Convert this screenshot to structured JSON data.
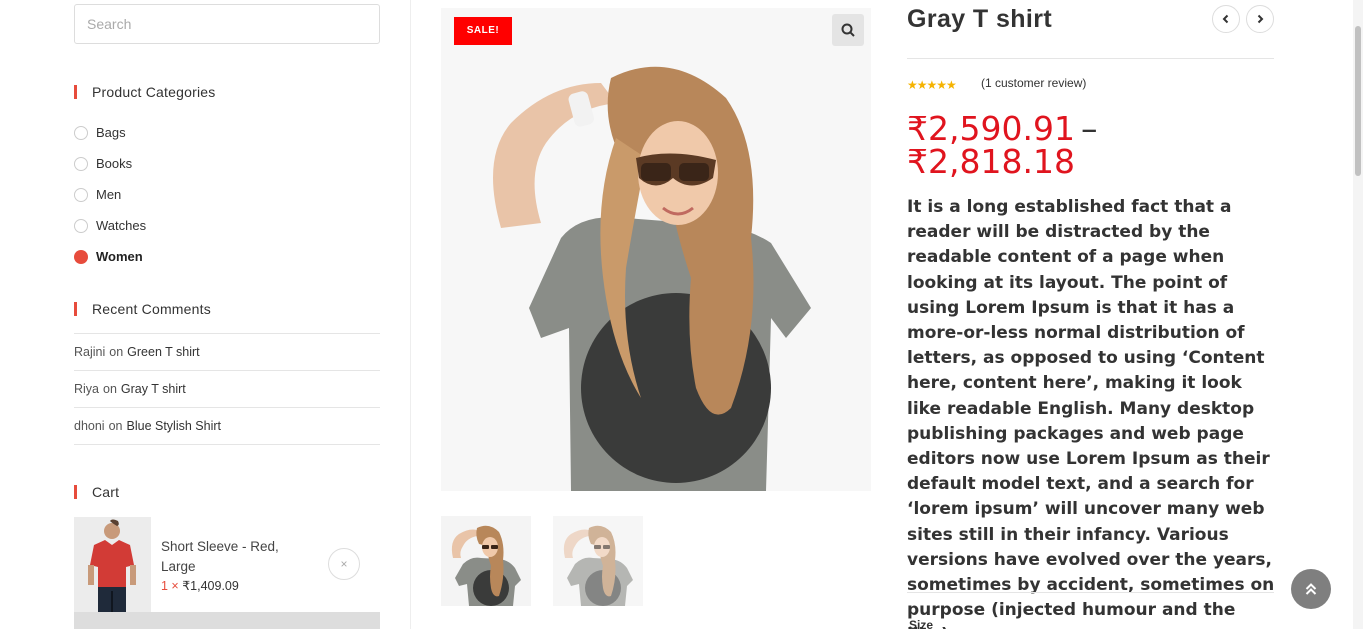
{
  "search": {
    "placeholder": "Search"
  },
  "categories": {
    "title": "Product Categories",
    "items": [
      {
        "label": "Bags"
      },
      {
        "label": "Books"
      },
      {
        "label": "Men"
      },
      {
        "label": "Watches"
      },
      {
        "label": "Women",
        "selected": true
      }
    ]
  },
  "recent_comments": {
    "title": "Recent Comments",
    "items": [
      {
        "author": "Rajini",
        "on": "on",
        "post": "Green T shirt"
      },
      {
        "author": "Riya",
        "on": "on",
        "post": "Gray T shirt"
      },
      {
        "author": "dhoni",
        "on": "on",
        "post": "Blue Stylish Shirt"
      }
    ]
  },
  "cart": {
    "title": "Cart",
    "item": {
      "name": "Short Sleeve - Red, Large",
      "qty": "1 ×",
      "price": "₹1,409.09",
      "remove": "×"
    }
  },
  "product": {
    "sale_badge": "SALE!",
    "title": "Gray T shirt",
    "rating_stars": "★★★★★",
    "review_text": "(1 customer review)",
    "price_min": "₹2,590.91",
    "price_sep": "–",
    "price_max": "₹2,818.18",
    "description": "It is a long established fact that a reader will be distracted by the readable content of a page when looking at its layout. The point of using Lorem Ipsum is that it has a more-or-less normal distribution of letters, as opposed to using ‘Content here, content here’, making it look like readable English. Many desktop publishing packages and web page editors now use Lorem Ipsum as their default model text, and a search for ‘lorem ipsum’ will uncover many web sites still in their infancy. Various versions have evolved over the years, sometimes by accident, sometimes on purpose (injected humour and the like).",
    "size_label": "Size"
  },
  "colors": {
    "accent": "#e74c3c",
    "price": "#e0141e",
    "sale_badge": "#ff0000",
    "stars": "#f5b301"
  },
  "icons": {
    "zoom": "search-icon",
    "prev": "chevron-left-icon",
    "next": "chevron-right-icon",
    "scroll_top": "double-chevron-up-icon"
  }
}
